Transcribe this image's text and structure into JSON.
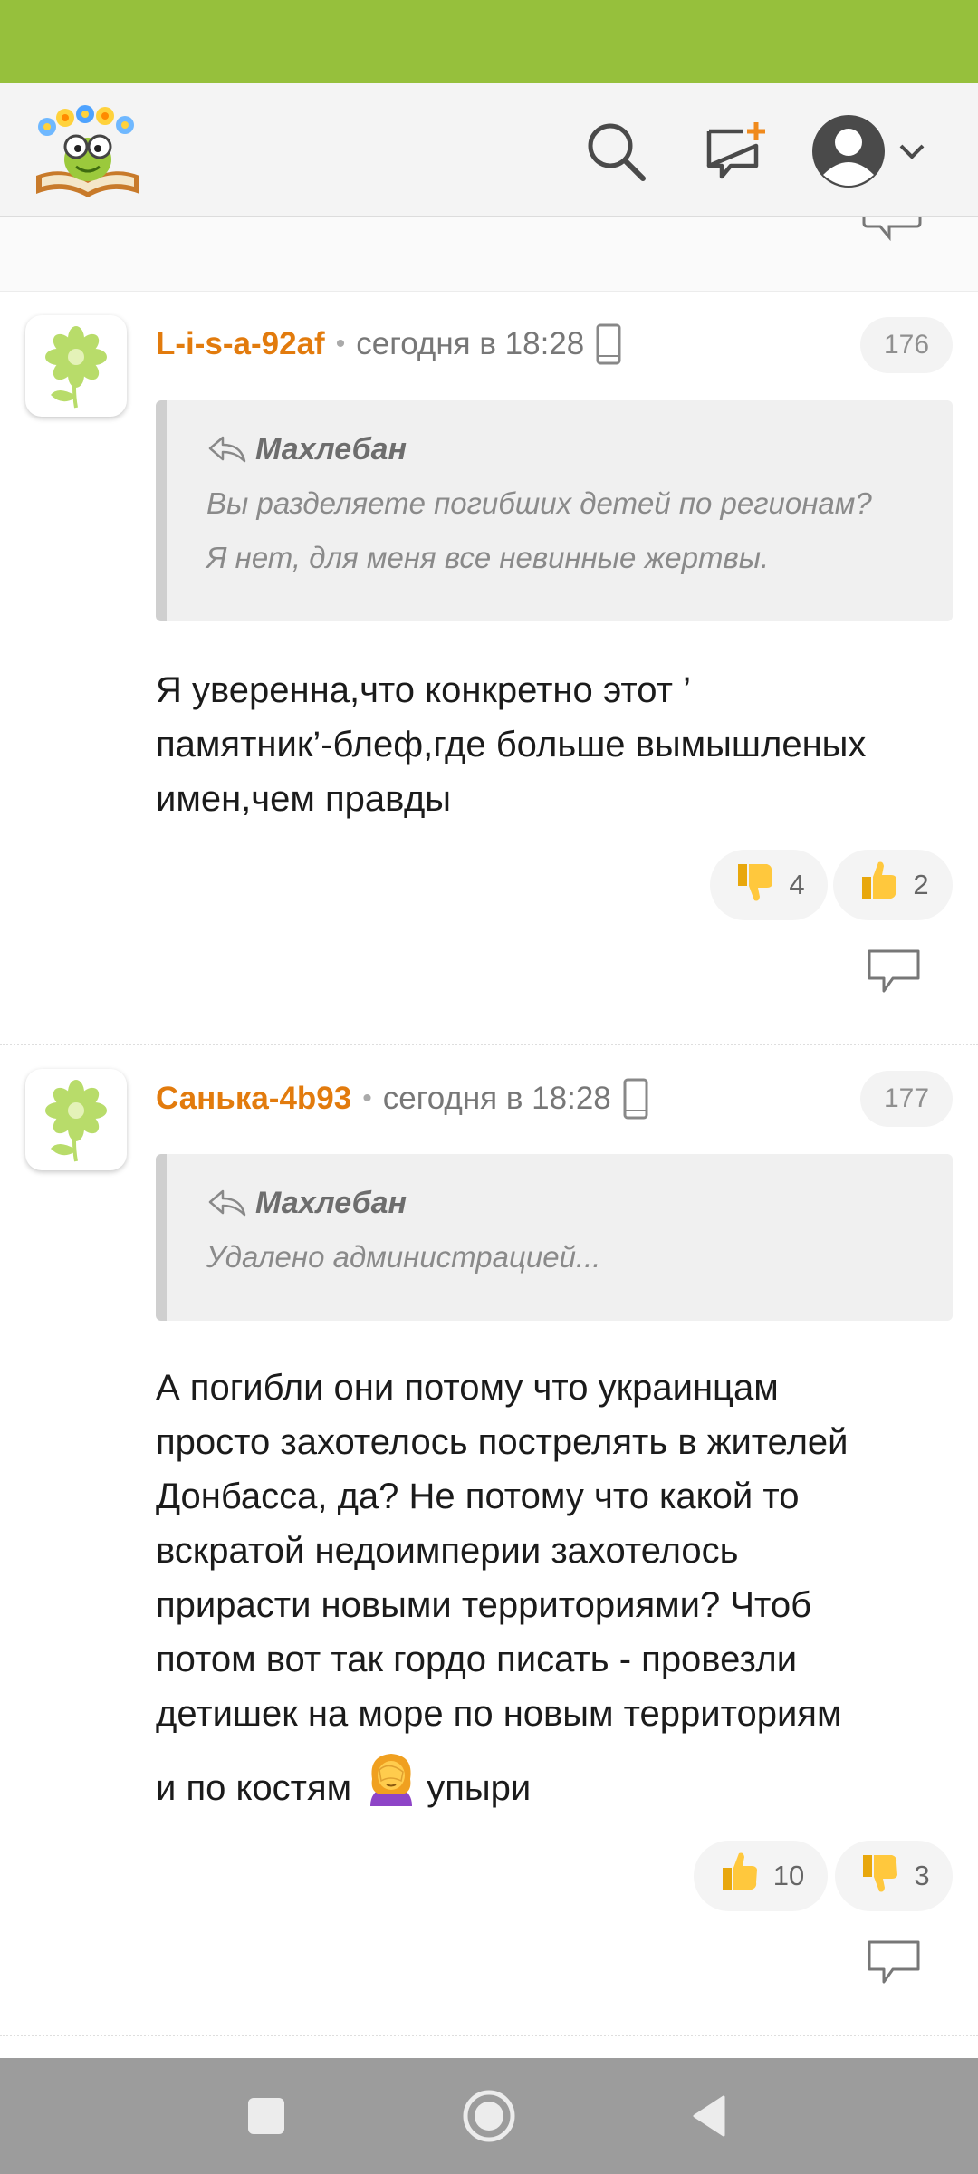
{
  "header": {
    "logo_name": "site-logo",
    "search_icon": "search-icon",
    "new_post_icon": "new-post-icon",
    "profile_icon": "avatar-icon",
    "dropdown_icon": "chevron-down-icon"
  },
  "comments": [
    {
      "author": "L-i-s-a-92af",
      "separator": "•",
      "time": "сегодня в 18:28",
      "number": "176",
      "quote": {
        "author": "Махлебан",
        "lines": [
          "Вы разделяете погибших детей по регионам?",
          "Я нет, для меня все невинные жертвы."
        ]
      },
      "body_lines": [
        "Я уверенна,что конкретно этот ’",
        "памятник’-блеф,где больше вымышленых",
        "имен,чем правды"
      ],
      "dislikes": "4",
      "likes": "2"
    },
    {
      "author": "Санька-4b93",
      "separator": "•",
      "time": "сегодня в 18:28",
      "number": "177",
      "quote": {
        "author": "Махлебан",
        "lines": [
          "Удалено администрацией..."
        ]
      },
      "body_lines": [
        "А погибли они потому что украинцам",
        "просто захотелось пострелять в жителей",
        "Донбасса, да? Не потому что какой то",
        "вскратой недоимперии захотелось",
        "прирасти новыми территориями? Чтоб",
        "потом вот так гордо писать - провезли",
        "детишек на море по новым территориям"
      ],
      "body_last_before": "и по костям ",
      "body_last_after": "упыри",
      "likes": "10",
      "dislikes": "3"
    }
  ],
  "colors": {
    "status_bar": "#96c03c",
    "author": "#e27b0d",
    "navbar": "#9c9c9c"
  }
}
